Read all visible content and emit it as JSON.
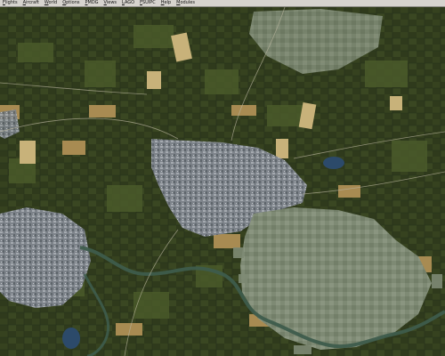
{
  "window": {
    "menu": [
      "Flights",
      "Aircraft",
      "World",
      "Options",
      "PMDG",
      "Views",
      "LAGO",
      "FSUIPC",
      "Help",
      "Modules"
    ]
  },
  "scenery": {
    "kind": "aerial satellite terrain view",
    "colors": {
      "farmland_dark": "#2f3a1c",
      "farmland_mid": "#4a5a2a",
      "field_tan": "#a88b52",
      "field_light": "#c8b27a",
      "city": "#8a8f95",
      "river": "#3e5c4c",
      "lake": "#2c4a6a",
      "low_res_patch": "#7e8a74"
    }
  }
}
